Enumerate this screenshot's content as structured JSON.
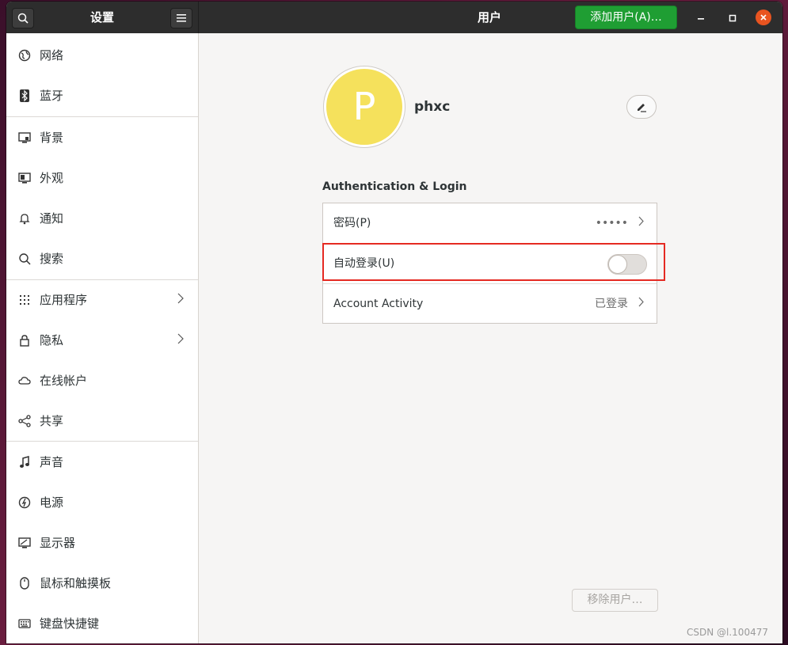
{
  "window": {
    "sidebar_title": "设置",
    "main_title": "用户",
    "add_user_label": "添加用户(A)…"
  },
  "sidebar": {
    "items": [
      {
        "label": "网络",
        "icon": "globe-icon"
      },
      {
        "label": "蓝牙",
        "icon": "bluetooth-icon"
      },
      {
        "label": "背景",
        "icon": "background-icon"
      },
      {
        "label": "外观",
        "icon": "appearance-icon"
      },
      {
        "label": "通知",
        "icon": "bell-icon"
      },
      {
        "label": "搜索",
        "icon": "search-icon"
      },
      {
        "label": "应用程序",
        "icon": "apps-grid-icon"
      },
      {
        "label": "隐私",
        "icon": "lock-icon"
      },
      {
        "label": "在线帐户",
        "icon": "cloud-icon"
      },
      {
        "label": "共享",
        "icon": "share-icon"
      },
      {
        "label": "声音",
        "icon": "music-note-icon"
      },
      {
        "label": "电源",
        "icon": "power-icon"
      },
      {
        "label": "显示器",
        "icon": "display-icon"
      },
      {
        "label": "鼠标和触摸板",
        "icon": "mouse-icon"
      },
      {
        "label": "键盘快捷键",
        "icon": "keyboard-icon"
      }
    ]
  },
  "user": {
    "avatar_letter": "P",
    "avatar_color": "#f5e15c",
    "name": "phxc"
  },
  "auth": {
    "section_title": "Authentication & Login",
    "password_label": "密码(P)",
    "password_value": "•••••",
    "autologin_label": "自动登录(U)",
    "autologin_enabled": false,
    "activity_label": "Account Activity",
    "activity_value": "已登录"
  },
  "remove_user_label": "移除用户…",
  "watermark": "CSDN @l.100477",
  "colors": {
    "accent_green": "#1f9e33",
    "close_orange": "#e95420",
    "highlight_red": "#e52a22"
  }
}
